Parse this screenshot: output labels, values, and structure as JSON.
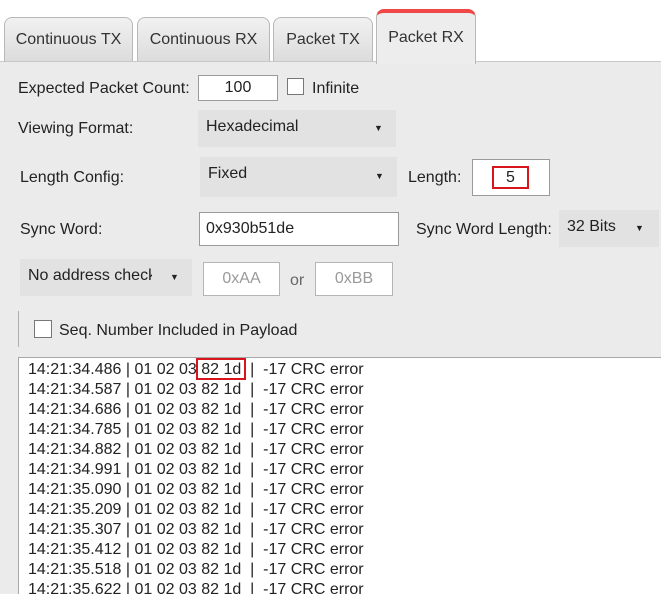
{
  "tabs": [
    {
      "label": "Continuous TX"
    },
    {
      "label": "Continuous RX"
    },
    {
      "label": "Packet TX"
    },
    {
      "label": "Packet RX"
    }
  ],
  "form": {
    "expected_count_label": "Expected Packet Count:",
    "expected_count_value": "100",
    "infinite_label": "Infinite",
    "infinite_checked": false,
    "viewing_format_label": "Viewing Format:",
    "viewing_format_value": "Hexadecimal",
    "length_config_label": "Length Config:",
    "length_config_value": "Fixed",
    "length_label": "Length:",
    "length_value": "5",
    "sync_word_label": "Sync Word:",
    "sync_word_value": "0x930b51de",
    "sync_word_length_label": "Sync Word Length:",
    "sync_word_length_value": "32 Bits",
    "address_check_value": "No address check",
    "address1_placeholder": "0xAA",
    "or_label": "or",
    "address2_placeholder": "0xBB",
    "seq_number_label": "Seq. Number Included in Payload",
    "seq_number_checked": false
  },
  "log": {
    "lines": [
      "14:21:34.486 | 01 02 03 82 1d  |  -17 CRC error",
      "14:21:34.587 | 01 02 03 82 1d  |  -17 CRC error",
      "14:21:34.686 | 01 02 03 82 1d  |  -17 CRC error",
      "14:21:34.785 | 01 02 03 82 1d  |  -17 CRC error",
      "14:21:34.882 | 01 02 03 82 1d  |  -17 CRC error",
      "14:21:34.991 | 01 02 03 82 1d  |  -17 CRC error",
      "14:21:35.090 | 01 02 03 82 1d  |  -17 CRC error",
      "14:21:35.209 | 01 02 03 82 1d  |  -17 CRC error",
      "14:21:35.307 | 01 02 03 82 1d  |  -17 CRC error",
      "14:21:35.412 | 01 02 03 82 1d  |  -17 CRC error",
      "14:21:35.518 | 01 02 03 82 1d  |  -17 CRC error",
      "14:21:35.622 | 01 02 03 82 1d  |  -17 CRC error"
    ]
  },
  "colors": {
    "active_tab_accent": "#f04747",
    "highlight_box": "#d8141c"
  },
  "icons": {
    "dropdown": "caret-down-icon"
  }
}
